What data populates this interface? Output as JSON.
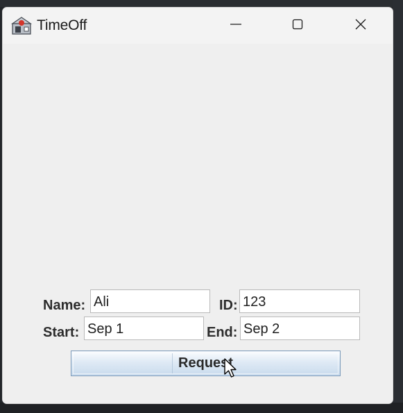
{
  "window": {
    "title": "TimeOff",
    "controls": {
      "minimize": "minimize-icon",
      "maximize": "maximize-icon",
      "close": "close-icon"
    }
  },
  "form": {
    "name_label": "Name:",
    "name_value": "Ali",
    "id_label": "ID:",
    "id_value": "123",
    "start_label": "Start:",
    "start_value": "Sep 1",
    "end_label": "End:",
    "end_value": "Sep 2",
    "submit_label": "Request"
  },
  "icons": {
    "app": "java-app-icon",
    "cursor": "mouse-pointer-icon"
  }
}
